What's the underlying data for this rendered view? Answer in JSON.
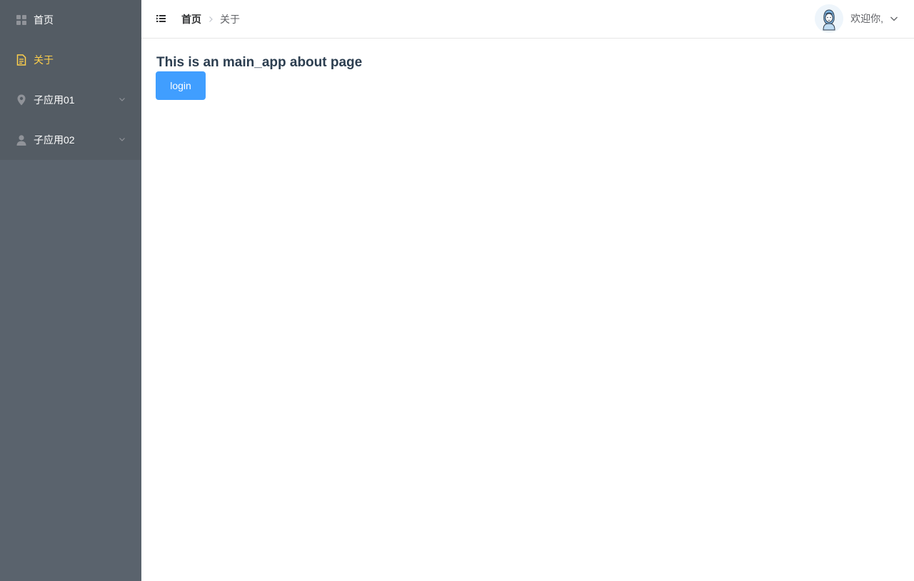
{
  "sidebar": {
    "background": "#545c64",
    "active_color": "#ffd04b",
    "items": [
      {
        "label": "首页",
        "icon": "grid-icon",
        "active": false,
        "submenu": false
      },
      {
        "label": "关于",
        "icon": "document-icon",
        "active": true,
        "submenu": false
      },
      {
        "label": "子应用01",
        "icon": "location-pin-icon",
        "active": false,
        "submenu": true
      },
      {
        "label": "子应用02",
        "icon": "user-icon",
        "active": false,
        "submenu": true
      }
    ]
  },
  "header": {
    "breadcrumb": {
      "home": "首页",
      "current": "关于"
    },
    "welcome": "欢迎你,",
    "avatar_icon": "user-avatar-icon"
  },
  "main": {
    "heading": "This is an main_app about page",
    "login_label": "login",
    "accent_color": "#409eff"
  }
}
